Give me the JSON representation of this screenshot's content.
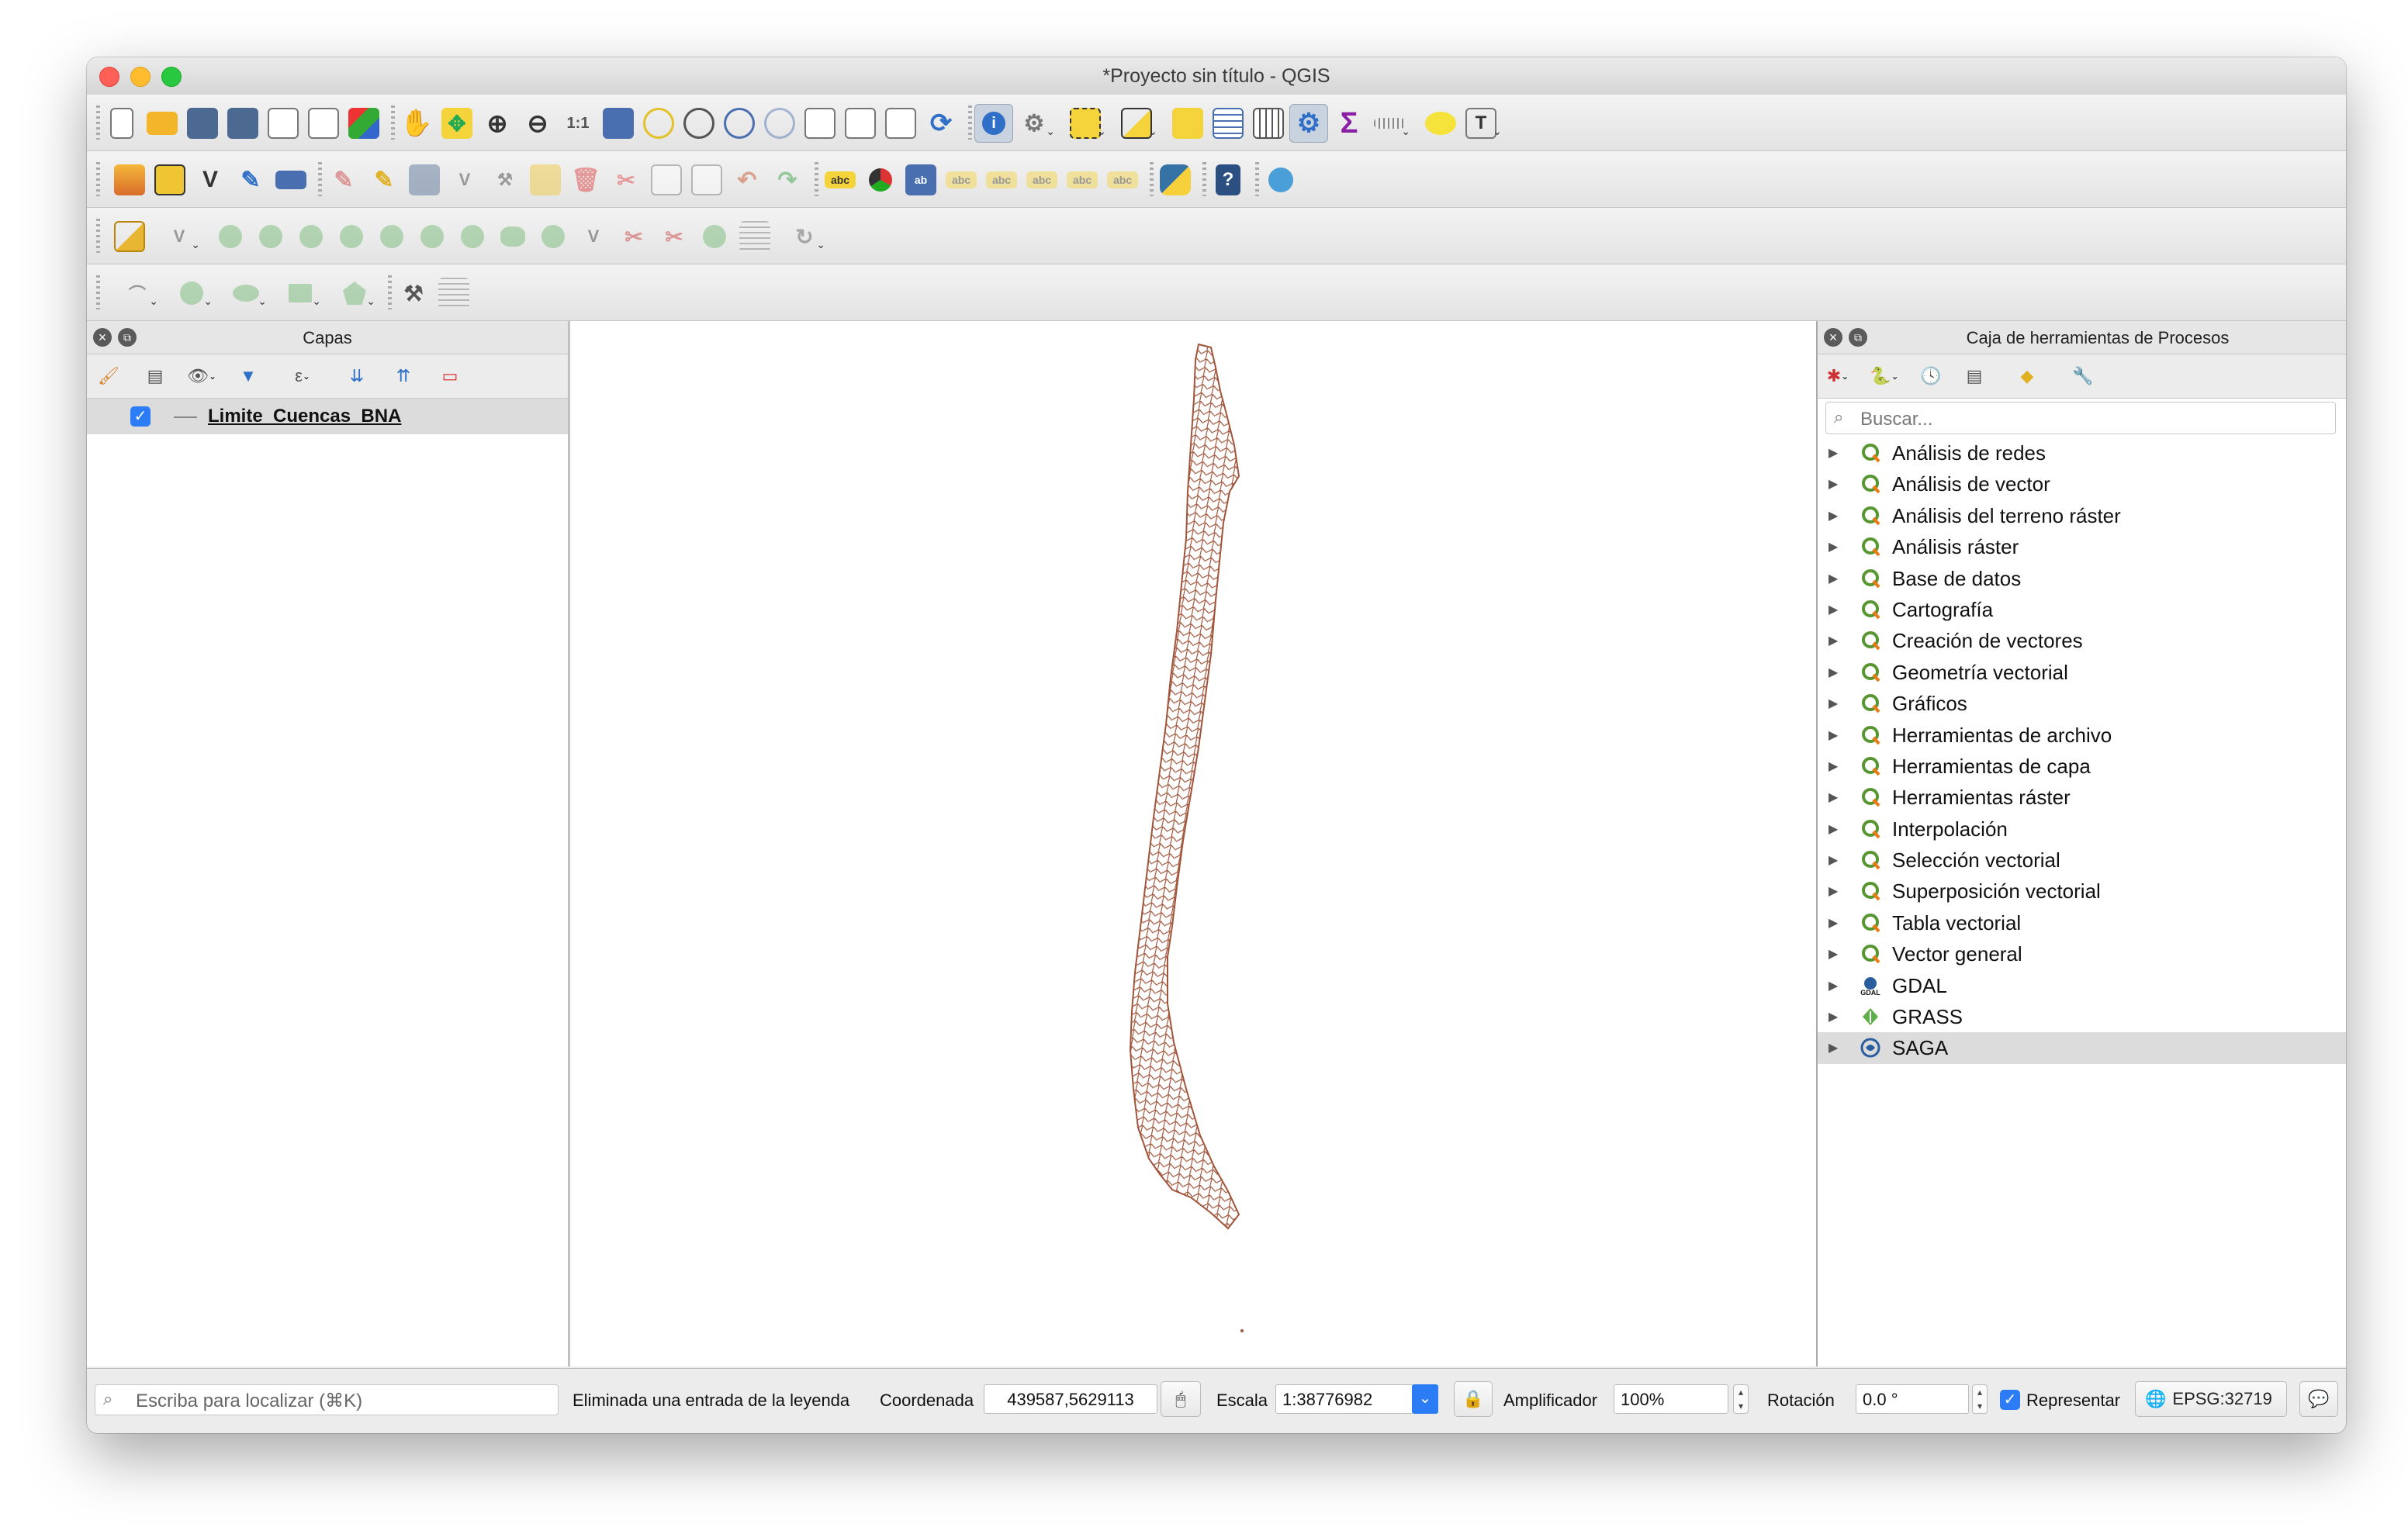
{
  "window": {
    "title": "*Proyecto sin título - QGIS"
  },
  "layers_panel": {
    "title": "Capas",
    "layers": [
      {
        "name": "Limite_Cuencas_BNA",
        "checked": true
      }
    ]
  },
  "processing_panel": {
    "title": "Caja de herramientas de Procesos",
    "search_placeholder": "Buscar...",
    "items": [
      {
        "label": "Análisis de redes",
        "icon": "qgis-icon"
      },
      {
        "label": "Análisis de vector",
        "icon": "qgis-icon"
      },
      {
        "label": "Análisis del terreno ráster",
        "icon": "qgis-icon"
      },
      {
        "label": "Análisis ráster",
        "icon": "qgis-icon"
      },
      {
        "label": "Base de datos",
        "icon": "qgis-icon"
      },
      {
        "label": "Cartografía",
        "icon": "qgis-icon"
      },
      {
        "label": "Creación de vectores",
        "icon": "qgis-icon"
      },
      {
        "label": "Geometría vectorial",
        "icon": "qgis-icon"
      },
      {
        "label": "Gráficos",
        "icon": "qgis-icon"
      },
      {
        "label": "Herramientas de archivo",
        "icon": "qgis-icon"
      },
      {
        "label": "Herramientas de capa",
        "icon": "qgis-icon"
      },
      {
        "label": "Herramientas ráster",
        "icon": "qgis-icon"
      },
      {
        "label": "Interpolación",
        "icon": "qgis-icon"
      },
      {
        "label": "Selección vectorial",
        "icon": "qgis-icon"
      },
      {
        "label": "Superposición vectorial",
        "icon": "qgis-icon"
      },
      {
        "label": "Tabla vectorial",
        "icon": "qgis-icon"
      },
      {
        "label": "Vector general",
        "icon": "qgis-icon"
      },
      {
        "label": "GDAL",
        "icon": "gdal-icon"
      },
      {
        "label": "GRASS",
        "icon": "grass-icon"
      },
      {
        "label": "SAGA",
        "icon": "saga-icon"
      }
    ],
    "selected": "SAGA"
  },
  "statusbar": {
    "locator_placeholder": "Escriba para localizar (⌘K)",
    "message": "Eliminada una entrada de la leyenda",
    "coordinate_label": "Coordenada",
    "coordinate_value": "439587,5629113",
    "scale_label": "Escala",
    "scale_value": "1:38776982",
    "magnifier_label": "Amplificador",
    "magnifier_value": "100%",
    "rotation_label": "Rotación",
    "rotation_value": "0.0 °",
    "render_label": "Representar",
    "render_checked": true,
    "crs": "EPSG:32719"
  },
  "colors": {
    "layer_stroke": "#a0543a",
    "accent": "#2c7cf6"
  }
}
